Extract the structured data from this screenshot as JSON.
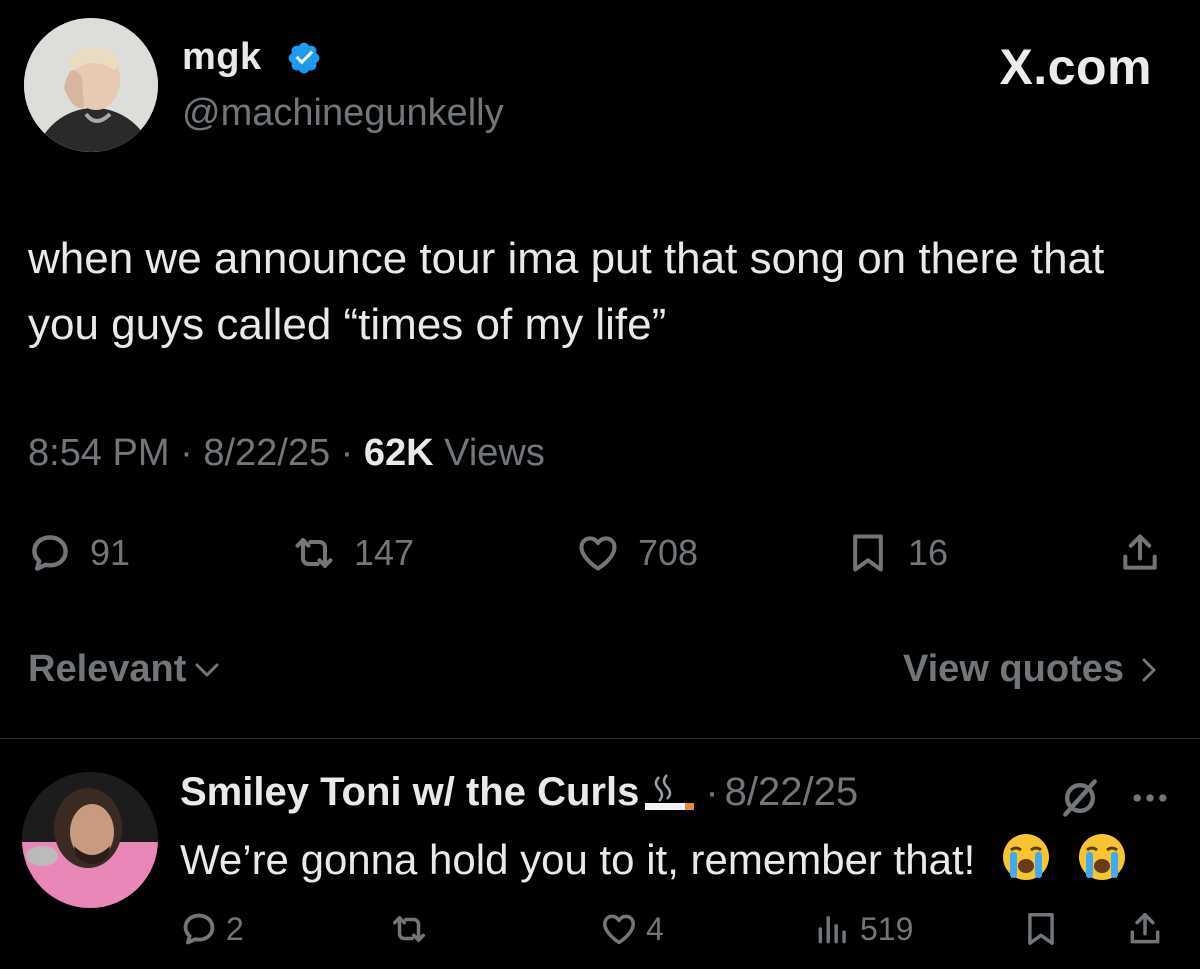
{
  "tweet": {
    "display_name": "mgk",
    "handle": "@machinegunkelly",
    "brand": "X.com",
    "text": "when we announce tour ima put that song on there that you guys called “times of my life”",
    "time": "8:54 PM",
    "date": "8/22/25",
    "views_count": "62K",
    "views_label": "Views",
    "replies": "91",
    "reposts": "147",
    "likes": "708",
    "bookmarks": "16"
  },
  "sort": {
    "label": "Relevant",
    "view_quotes": "View quotes"
  },
  "reply": {
    "name": "Smiley Toni w/ the Curls",
    "date": "8/22/25",
    "text": "We’re gonna hold you to it, remember that!",
    "replies": "2",
    "likes": "4",
    "views": "519"
  },
  "colors": {
    "background": "#000000",
    "text": "#e7e9ea",
    "muted": "#71767b",
    "verified": "#1d9bf0"
  },
  "icons": [
    "verified-badge-icon",
    "reply-icon",
    "repost-icon",
    "like-icon",
    "bookmark-icon",
    "share-icon",
    "chevron-down-icon",
    "chevron-right-icon",
    "cigarette-emoji",
    "crying-face-emoji",
    "no-link-icon",
    "more-icon",
    "views-icon"
  ]
}
